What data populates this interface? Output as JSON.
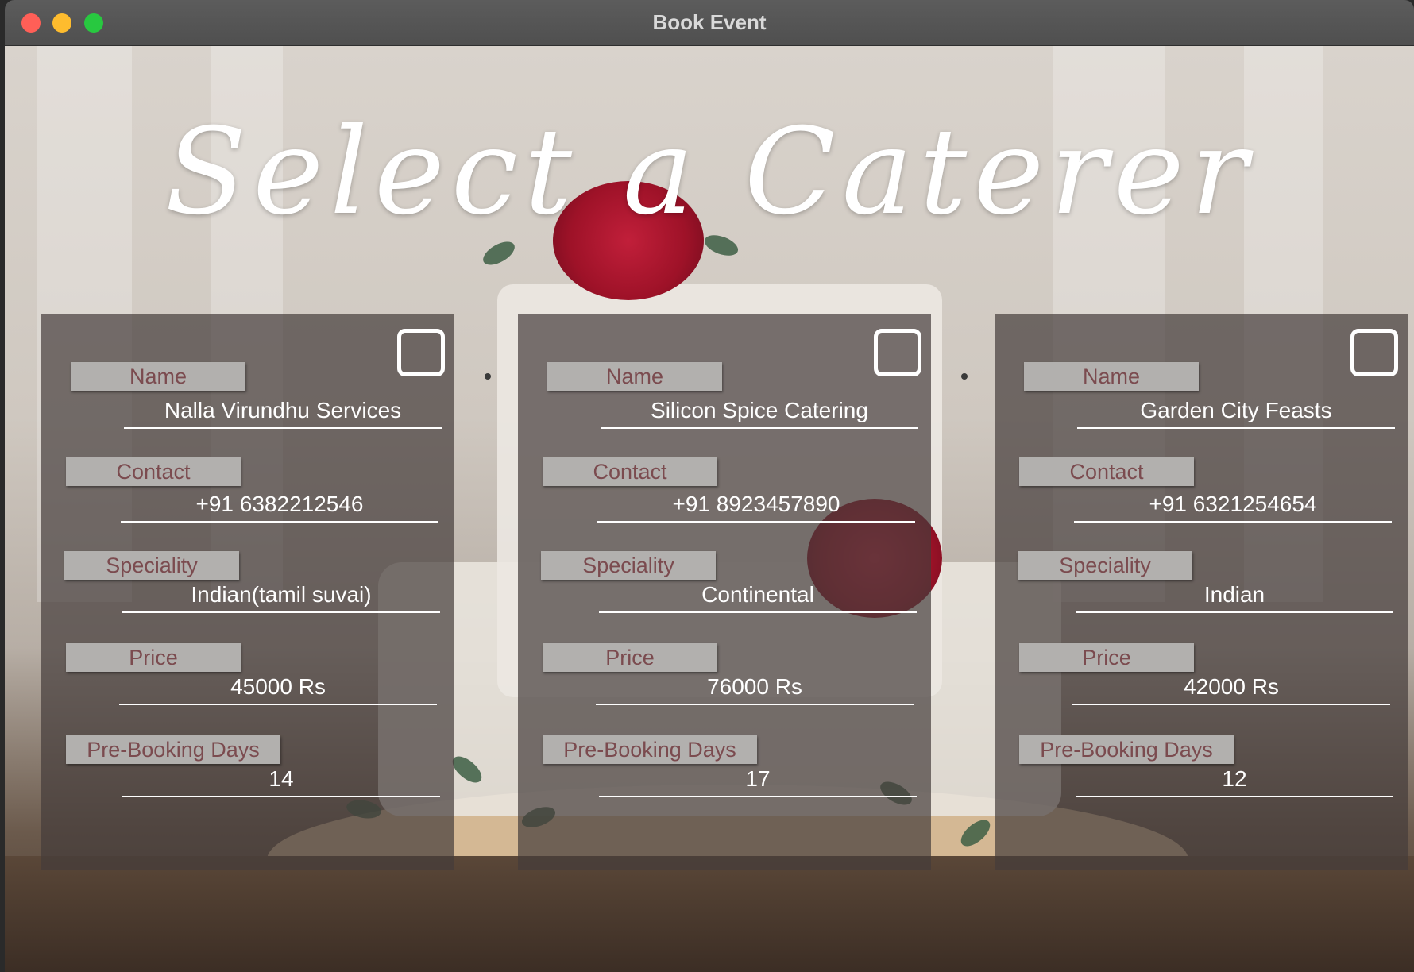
{
  "window": {
    "title": "Book Event"
  },
  "heading": "Select a Caterer",
  "field_labels": {
    "name": "Name",
    "contact": "Contact",
    "speciality": "Speciality",
    "price": "Price",
    "prebooking": "Pre-Booking Days"
  },
  "caterers": [
    {
      "name": "Nalla Virundhu Services",
      "contact": "+91 6382212546",
      "speciality": "Indian(tamil suvai)",
      "price": "45000 Rs",
      "prebooking": "14"
    },
    {
      "name": "Silicon Spice Catering",
      "contact": "+91 8923457890",
      "speciality": "Continental",
      "price": "76000 Rs",
      "prebooking": "17"
    },
    {
      "name": "Garden City Feasts",
      "contact": "+91 6321254654",
      "speciality": "Indian",
      "price": "42000 Rs",
      "prebooking": "12"
    }
  ]
}
